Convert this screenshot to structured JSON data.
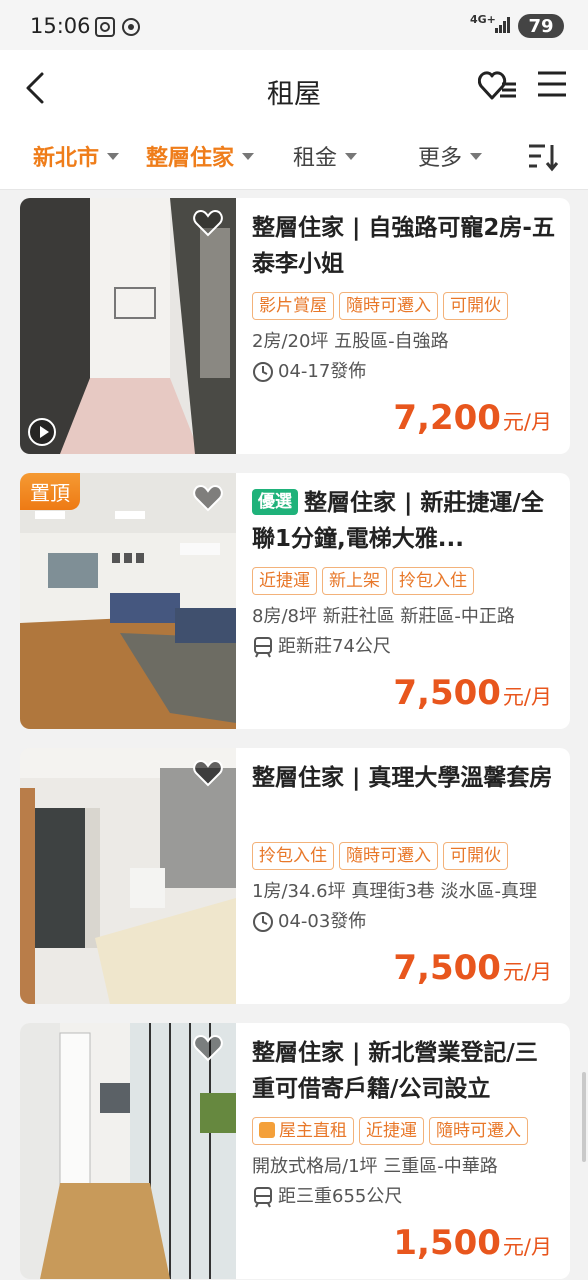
{
  "status_bar": {
    "time": "15:06",
    "network": "4G+",
    "battery": "79"
  },
  "header": {
    "title": "租屋"
  },
  "filters": [
    {
      "label": "新北市",
      "active": true
    },
    {
      "label": "整層住家",
      "active": true
    },
    {
      "label": "租金",
      "active": false
    },
    {
      "label": "更多",
      "active": false
    }
  ],
  "listings": [
    {
      "title": "整層住家 | 自強路可寵2房-五泰李小姐",
      "badge": "",
      "pinned": "",
      "has_video": true,
      "tags": [
        "影片賞屋",
        "隨時可遷入",
        "可開伙"
      ],
      "spec": "2房/20坪 五股區-自強路",
      "meta_icon": "clock-icon",
      "meta": "04-17發佈",
      "price": "7,200",
      "unit": "元/月"
    },
    {
      "title": "整層住家 | 新莊捷運/全聯1分鐘,電梯大雅...",
      "badge": "優選",
      "pinned": "置頂",
      "has_video": false,
      "tags": [
        "近捷運",
        "新上架",
        "拎包入住"
      ],
      "spec": "8房/8坪 新莊社區 新莊區-中正路",
      "meta_icon": "train-icon",
      "meta": "距新莊74公尺",
      "price": "7,500",
      "unit": "元/月"
    },
    {
      "title": "整層住家 | 真理大學溫馨套房",
      "badge": "",
      "pinned": "",
      "has_video": false,
      "tags": [
        "拎包入住",
        "隨時可遷入",
        "可開伙"
      ],
      "spec": "1房/34.6坪 真理街3巷 淡水區-真理",
      "meta_icon": "clock-icon",
      "meta": "04-03發佈",
      "price": "7,500",
      "unit": "元/月"
    },
    {
      "title": "整層住家 | 新北營業登記/三重可借寄戶籍/公司設立",
      "badge": "",
      "pinned": "",
      "has_video": false,
      "tags": [
        "屋主直租",
        "近捷運",
        "隨時可遷入"
      ],
      "spec": "開放式格局/1坪 三重區-中華路",
      "meta_icon": "train-icon",
      "meta": "距三重655公尺",
      "price": "1,500",
      "unit": "元/月"
    }
  ]
}
